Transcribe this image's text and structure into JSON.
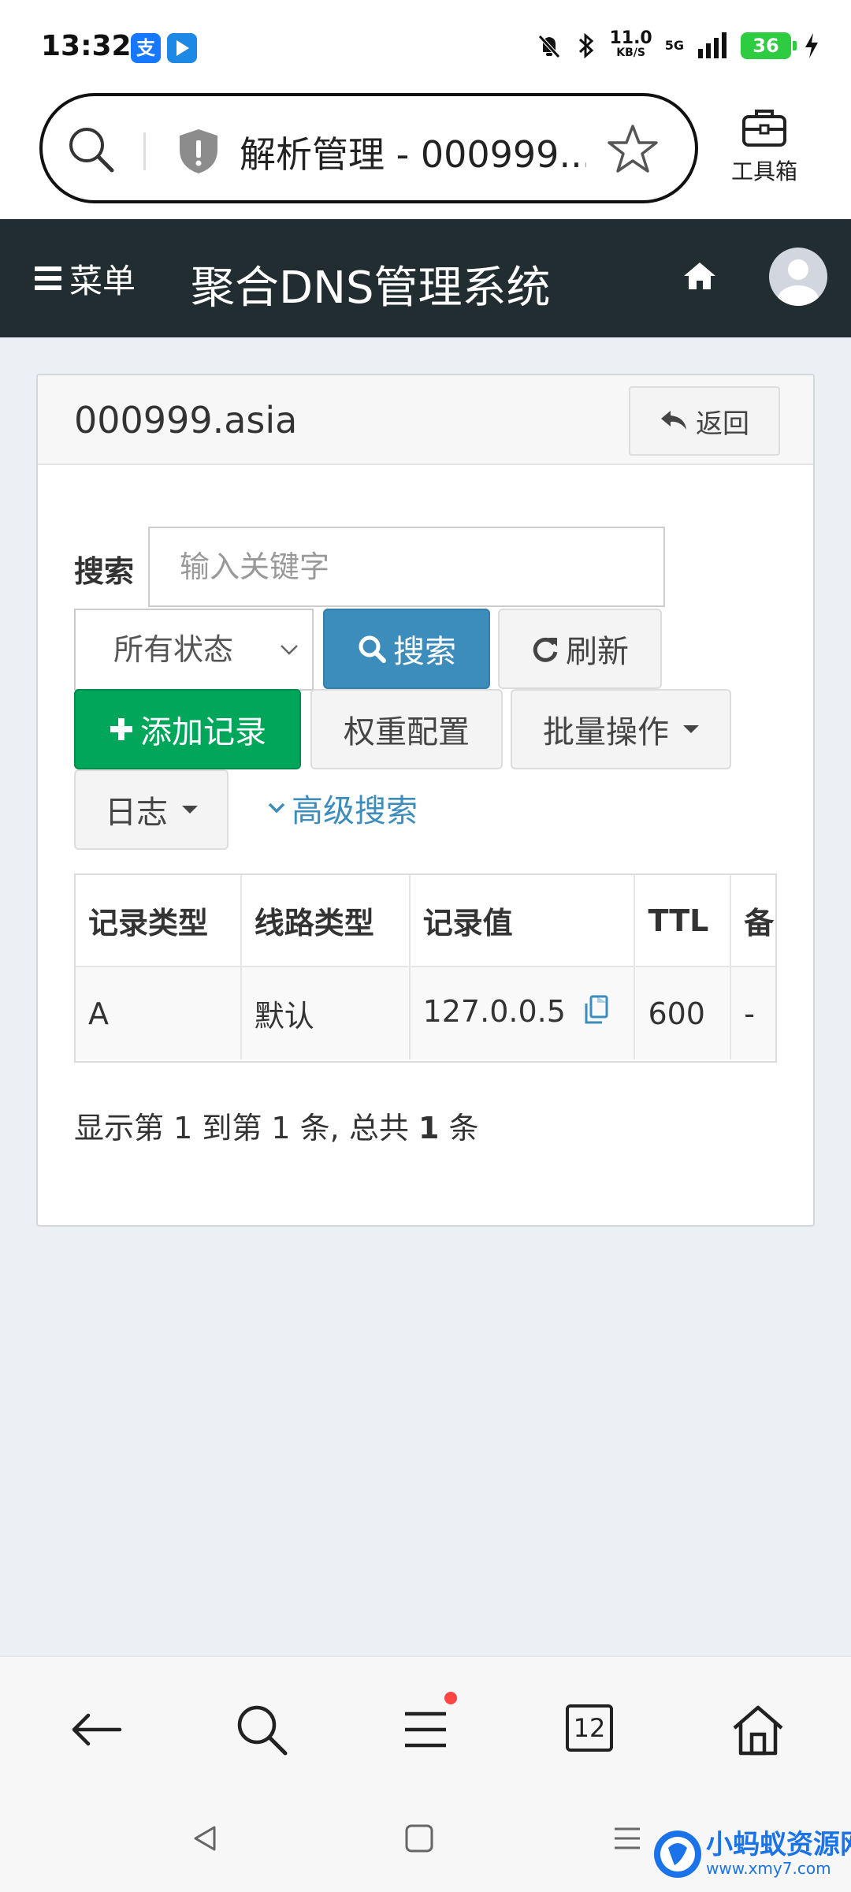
{
  "status_bar": {
    "time": "13:32",
    "net_speed_value": "11.0",
    "net_speed_unit": "KB/S",
    "network": "5G",
    "battery": "36"
  },
  "browser": {
    "page_title": "解析管理 - 000999...",
    "toolbox_label": "工具箱"
  },
  "header": {
    "menu_label": "菜单",
    "app_title": "聚合DNS管理系统"
  },
  "box": {
    "domain": "000999.asia",
    "back_label": "返回"
  },
  "toolbar": {
    "search_label": "搜索",
    "search_placeholder": "输入关键字",
    "status_select_value": "所有状态",
    "search_button": "搜索",
    "refresh_button": "刷新",
    "add_record_button": "添加记录",
    "weight_config_button": "权重配置",
    "batch_ops_button": "批量操作",
    "log_button": "日志",
    "advanced_search": "高级搜索"
  },
  "table": {
    "columns": [
      "记录类型",
      "线路类型",
      "记录值",
      "TTL",
      "备"
    ],
    "rows": [
      {
        "type": "A",
        "line": "默认",
        "value": "127.0.0.5",
        "ttl": "600",
        "remark": "-"
      }
    ]
  },
  "pagination": {
    "prefix": "显示第 1 到第 1 条, 总共",
    "total": "1",
    "suffix": "条"
  },
  "bottom_nav": {
    "tab_count": "12"
  },
  "watermark": {
    "title": "小蚂蚁资源网",
    "url": "www.xmy7.com"
  },
  "colors": {
    "header_bg": "#222d32",
    "primary": "#3c8dbc",
    "success": "#00a65a",
    "page_bg": "#ecf0f5"
  }
}
